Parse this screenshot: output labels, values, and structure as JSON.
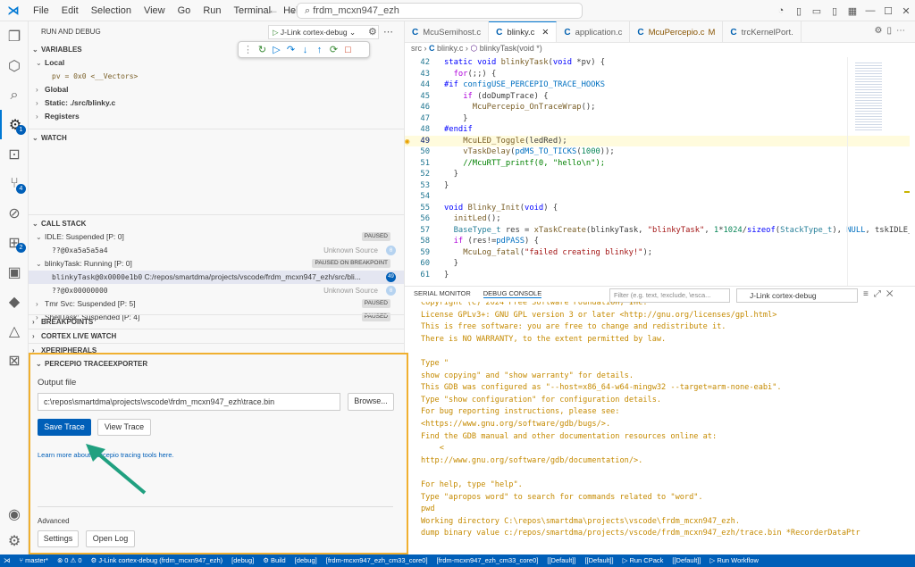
{
  "titlebar": {
    "menus": [
      "File",
      "Edit",
      "Selection",
      "View",
      "Go",
      "Run",
      "Terminal",
      "Help"
    ],
    "search": "frdm_mcxn947_ezh"
  },
  "sidebar": {
    "header": "RUN AND DEBUG",
    "config": "J-Link cortex-debug",
    "variables": {
      "title": "VARIABLES",
      "local": "Local",
      "pv": "pv = 0x0 <__Vectors>",
      "global": "Global",
      "static": "Static: ./src/blinky.c",
      "registers": "Registers"
    },
    "watch": "WATCH",
    "callstack": {
      "title": "CALL STACK",
      "idle": "IDLE: Suspended [P: 0]",
      "idle_tag": "PAUSED",
      "idle_frame": "??@0xa5a5a5a4",
      "unknown1": "Unknown Source",
      "c1": "0",
      "blinky": "blinkyTask: Running [P: 0]",
      "blinky_tag": "PAUSED ON BREAKPOINT",
      "frame_fn": "blinkyTask@0x0000e1b0",
      "frame_path": "C:/repos/smartdma/projects/vscode/frdm_mcxn947_ezh/src/bli...",
      "frame_line": "49",
      "frame2": "??@0x00000000",
      "unknown2": "Unknown Source",
      "c2": "0",
      "tmr": "Tmr Svc: Suspended [P: 5]",
      "tmr_tag": "PAUSED",
      "shell": "ShellTask: Suspended [P: 4]",
      "shell_tag": "PAUSED"
    },
    "breakpoints": "BREAKPOINTS",
    "cortex": "CORTEX LIVE WATCH",
    "xperipherals": "XPERIPHERALS",
    "percepio": {
      "title": "PERCEPIO TRACEEXPORTER",
      "output_label": "Output file",
      "output_value": "c:\\repos\\smartdma\\projects\\vscode\\frdm_mcxn947_ezh\\trace.bin",
      "browse": "Browse...",
      "save": "Save Trace",
      "view": "View Trace",
      "learn": "Learn more about Percepio tracing tools here.",
      "advanced": "Advanced",
      "settings": "Settings",
      "openlog": "Open Log"
    }
  },
  "tabs": [
    "McuSemihost.c",
    "blinky.c",
    "application.c",
    "McuPercepio.c",
    "trcKernelPort."
  ],
  "tab_suffix": {
    "percepio": "M"
  },
  "breadcrumb": [
    "src",
    "blinky.c",
    "blinkyTask(void *)"
  ],
  "panel": {
    "tabs": [
      "SERIAL MONITOR",
      "DEBUG CONSOLE"
    ],
    "filter": "Filter (e.g. text, !exclude, \\esca...",
    "config": "J-Link cortex-debug",
    "lines": [
      "Copyright (C) 2024 Free Software Foundation, Inc.",
      "License GPLv3+: GNU GPL version 3 or later <http://gnu.org/licenses/gpl.html>",
      "This is free software: you are free to change and redistribute it.",
      "There is NO WARRANTY, to the extent permitted by law.",
      "",
      "Type \"",
      "show copying\" and \"show warranty\" for details.",
      "This GDB was configured as \"--host=x86_64-w64-mingw32 --target=arm-none-eabi\".",
      "Type \"show configuration\" for configuration details.",
      "For bug reporting instructions, please see:",
      "<https://www.gnu.org/software/gdb/bugs/>.",
      "Find the GDB manual and other documentation resources online at:",
      "    <",
      "http://www.gnu.org/software/gdb/documentation/>.",
      "",
      "For help, type \"help\".",
      "Type \"apropos word\" to search for commands related to \"word\".",
      "pwd",
      "Working directory C:\\repos\\smartdma\\projects\\vscode\\frdm_mcxn947_ezh.",
      "dump binary value c:/repos/smartdma/projects/vscode/frdm_mcxn947_ezh/trace.bin *RecorderDataPtr"
    ]
  },
  "status": [
    "master*",
    "⊗ 0 ⚠ 0",
    "J-Link cortex-debug (frdm_mcxn947_ezh)",
    "[debug]",
    "Build",
    "[debug]",
    "[frdm-mcxn947_ezh_cm33_core0]",
    "[frdm-mcxn947_ezh_cm33_core0]",
    "[[Default]]",
    "[[Default]]",
    "Run CPack",
    "[[Default]]",
    "Run Workflow"
  ]
}
